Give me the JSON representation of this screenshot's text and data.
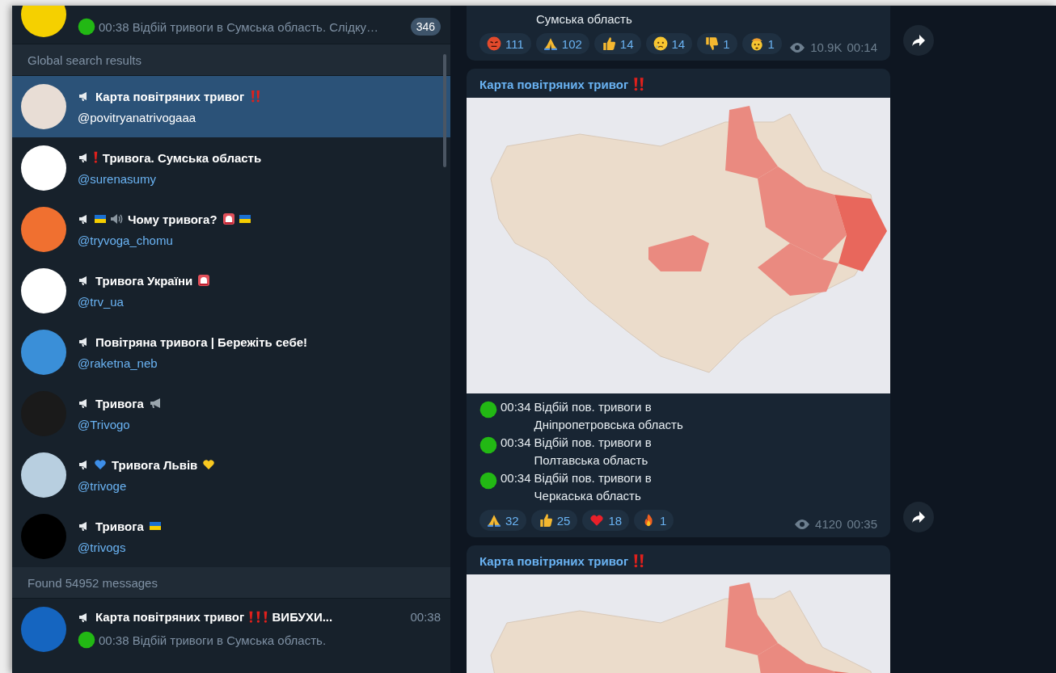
{
  "chat_list": {
    "top_item": {
      "avatar": {
        "color": "#f5d000"
      },
      "preview": [
        {
          "kind": "dot",
          "color": "#22b814"
        },
        {
          "kind": "text",
          "text": "00:38 Відбій тривоги в Сумська область. Слідку…"
        }
      ],
      "unread": "346"
    },
    "sections": [
      {
        "title": "Global search results",
        "items": [
          {
            "avatar": {
              "color": "#e8ddd5"
            },
            "selected": true,
            "name": [
              {
                "kind": "megaphone"
              },
              {
                "kind": "text",
                "text": "Карта повітряних тривог"
              },
              {
                "kind": "bangs"
              }
            ],
            "handle": "@povitryanatrivogaaa"
          },
          {
            "avatar": {
              "color": "#ffffff"
            },
            "selected": false,
            "name": [
              {
                "kind": "megaphone"
              },
              {
                "kind": "bang"
              },
              {
                "kind": "text",
                "text": "Тривога. Сумська область"
              }
            ],
            "handle": "@surenasumy"
          },
          {
            "avatar": {
              "color": "#f07030"
            },
            "selected": false,
            "name": [
              {
                "kind": "megaphone"
              },
              {
                "kind": "flag"
              },
              {
                "kind": "speaker"
              },
              {
                "kind": "text",
                "text": "Чому тривога?"
              },
              {
                "kind": "siren"
              },
              {
                "kind": "flag"
              }
            ],
            "handle": "@tryvoga_chomu"
          },
          {
            "avatar": {
              "color": "#ffffff"
            },
            "selected": false,
            "name": [
              {
                "kind": "megaphone"
              },
              {
                "kind": "text",
                "text": "Тривога України"
              },
              {
                "kind": "siren"
              }
            ],
            "handle": "@trv_ua"
          },
          {
            "avatar": {
              "color": "#3a8fd8"
            },
            "selected": false,
            "name": [
              {
                "kind": "megaphone"
              },
              {
                "kind": "text",
                "text": "Повітряна тривога | Бережіть себе!"
              }
            ],
            "handle": "@raketna_neb"
          },
          {
            "avatar": {
              "color": "#1a1a1a"
            },
            "selected": false,
            "name": [
              {
                "kind": "megaphone"
              },
              {
                "kind": "text",
                "text": "Тривога"
              },
              {
                "kind": "horn"
              }
            ],
            "handle": "@Trivogo"
          },
          {
            "avatar": {
              "color": "#b8cfe0"
            },
            "selected": false,
            "name": [
              {
                "kind": "megaphone"
              },
              {
                "kind": "heart",
                "color": "#3d8ee8"
              },
              {
                "kind": "text",
                "text": "Тривога Львів"
              },
              {
                "kind": "heart",
                "color": "#f8c820"
              }
            ],
            "handle": "@trivoge"
          },
          {
            "avatar": {
              "color": "#000000"
            },
            "selected": false,
            "name": [
              {
                "kind": "megaphone"
              },
              {
                "kind": "text",
                "text": "Тривога"
              },
              {
                "kind": "flag"
              }
            ],
            "handle": "@trivogs"
          }
        ]
      },
      {
        "title": "Found 54952 messages",
        "items": [
          {
            "avatar": {
              "color": "#1565c0"
            },
            "selected": false,
            "name": [
              {
                "kind": "megaphone"
              },
              {
                "kind": "text",
                "text": "Карта повітряних тривог"
              },
              {
                "kind": "bang"
              },
              {
                "kind": "bang"
              },
              {
                "kind": "bang"
              },
              {
                "kind": "text",
                "text": "ВИБУХИ..."
              }
            ],
            "time": "00:38",
            "preview": [
              {
                "kind": "dot",
                "color": "#22b814"
              },
              {
                "kind": "text",
                "text": "00:38 Відбій тривоги в Сумська область."
              }
            ]
          }
        ]
      }
    ]
  },
  "messages": [
    {
      "lines": [
        {
          "kind": "continuation",
          "text": "Сумська область"
        }
      ],
      "reactions": [
        {
          "kind": "angry",
          "count": "111"
        },
        {
          "kind": "pray",
          "count": "102"
        },
        {
          "kind": "like",
          "count": "14"
        },
        {
          "kind": "cry",
          "count": "14"
        },
        {
          "kind": "dislike",
          "count": "1"
        },
        {
          "kind": "exploding",
          "count": "1"
        }
      ],
      "views": "10.9K",
      "time": "00:14"
    },
    {
      "title": [
        {
          "kind": "text",
          "text": "Карта повітряних тривог"
        },
        {
          "kind": "bangs"
        }
      ],
      "map": true,
      "lines": [
        {
          "kind": "alert",
          "time": "00:34",
          "text": "Відбій пов. тривоги в Дніпропетровська область"
        },
        {
          "kind": "alert",
          "time": "00:34",
          "text": "Відбій пов. тривоги в Полтавська область"
        },
        {
          "kind": "alert",
          "time": "00:34",
          "text": "Відбій пов. тривоги в Черкаська область"
        }
      ],
      "reactions": [
        {
          "kind": "pray",
          "count": "32"
        },
        {
          "kind": "like",
          "count": "25"
        },
        {
          "kind": "heart",
          "color": "#e8202a",
          "count": "18"
        },
        {
          "kind": "fire",
          "count": "1"
        }
      ],
      "views": "4120",
      "time": "00:35"
    },
    {
      "title": [
        {
          "kind": "text",
          "text": "Карта повітряних тривог"
        },
        {
          "kind": "bangs"
        }
      ],
      "map": true
    }
  ]
}
